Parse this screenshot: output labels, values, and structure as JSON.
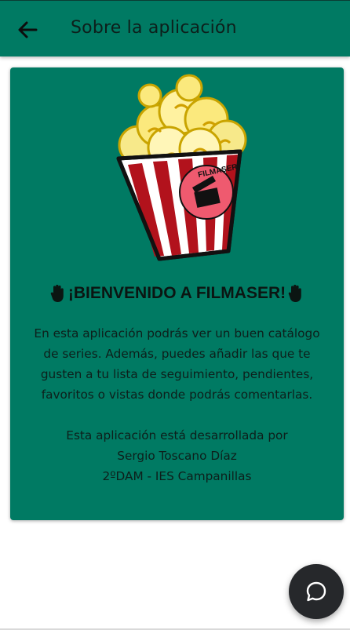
{
  "appbar": {
    "title": "Sobre la aplicación",
    "back_icon": "arrow-left-icon",
    "color": "#007a63"
  },
  "card": {
    "logo_text": "FILMASER",
    "welcome": "¡BIENVENIDO A FILMASER!",
    "welcome_icon": "raised-hand-icon",
    "description": "En esta aplicación podrás ver un buen catálogo de series. Además, puedes añadir las que te gusten a tu lista de seguimiento, pendientes, favoritos o vistas donde podrás comentarlas.",
    "credits": {
      "line1": "Esta aplicación está desarrollada por",
      "line2": "Sergio Toscano Díaz",
      "line3": "2ºDAM - IES Campanillas"
    }
  },
  "fab": {
    "icon": "chat-bubble-icon"
  }
}
